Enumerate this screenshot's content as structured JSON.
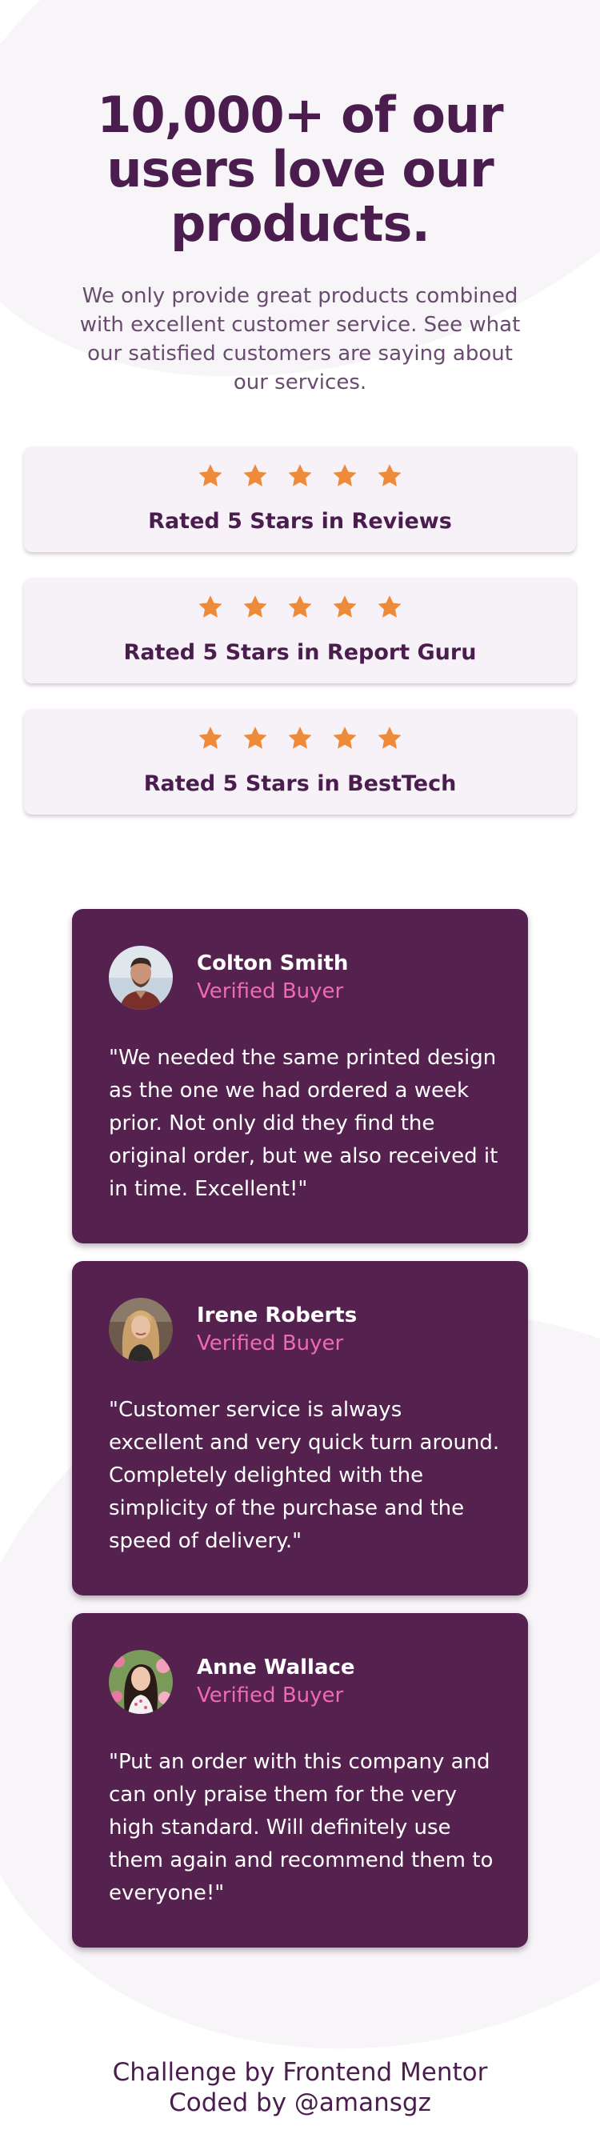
{
  "hero": {
    "title_line1": "10,000+ of our",
    "title_line2": "users love our",
    "title_line3": "products.",
    "description": "We only provide great products combined with excellent customer service. See what our satisfied customers are saying about our services."
  },
  "ratings": [
    {
      "label": "Rated 5 Stars in Reviews",
      "stars": 5
    },
    {
      "label": "Rated 5 Stars in Report Guru",
      "stars": 5
    },
    {
      "label": "Rated 5 Stars in BestTech",
      "stars": 5
    }
  ],
  "testimonials": [
    {
      "name": "Colton Smith",
      "role": "Verified Buyer",
      "quote": "\"We needed the same printed design as the one we had ordered a week prior. Not only did they find the original order, but we also received it in time. Excellent!\""
    },
    {
      "name": "Irene Roberts",
      "role": "Verified Buyer",
      "quote": "\"Customer service is always excellent and very quick turn around. Completely delighted with the simplicity of the purchase and the speed of delivery.\""
    },
    {
      "name": "Anne Wallace",
      "role": "Verified Buyer",
      "quote": "\"Put an order with this company and can only praise them for the very high standard. Will definitely use them again and recommend them to everyone!\""
    }
  ],
  "footer": {
    "line1": "Challenge by Frontend Mentor",
    "line2": "Coded by @amansgz"
  },
  "colors": {
    "primary": "#4a1d4e",
    "card_bg": "#55214f",
    "accent_pink": "#ee6ab4",
    "star": "#ee8b3b",
    "rating_bg": "#f6f2f7"
  },
  "icons": {
    "star": "star-icon",
    "avatar": "avatar-photo"
  }
}
